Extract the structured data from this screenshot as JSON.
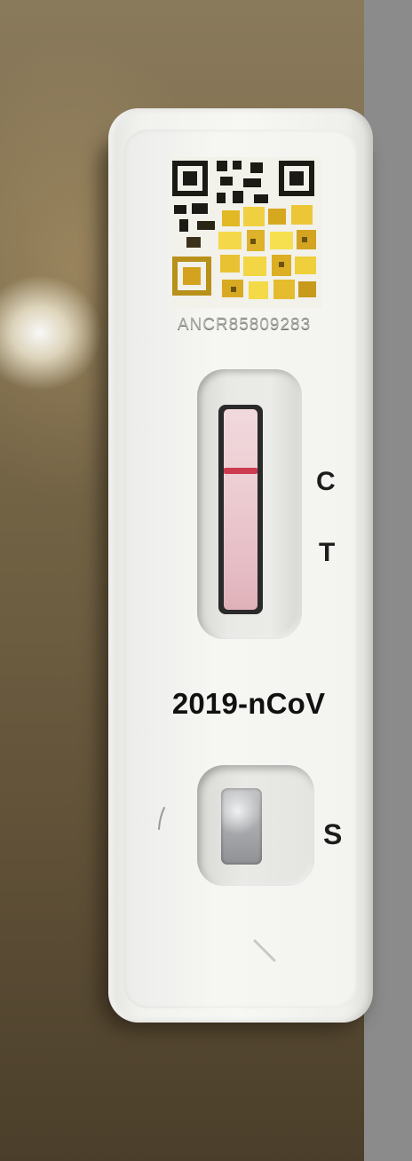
{
  "cassette": {
    "serial_number": "ANCR85809283",
    "brand_name": "2019-nCoV",
    "markers": {
      "control": "C",
      "test": "T",
      "sample": "S"
    }
  },
  "colors": {
    "control_line": "#cc3a4f",
    "strip": "#eccdd2",
    "cassette": "#f4f4f1",
    "qr_code": "#e8c22a"
  },
  "icons": {
    "qr": "qr-code-icon"
  }
}
